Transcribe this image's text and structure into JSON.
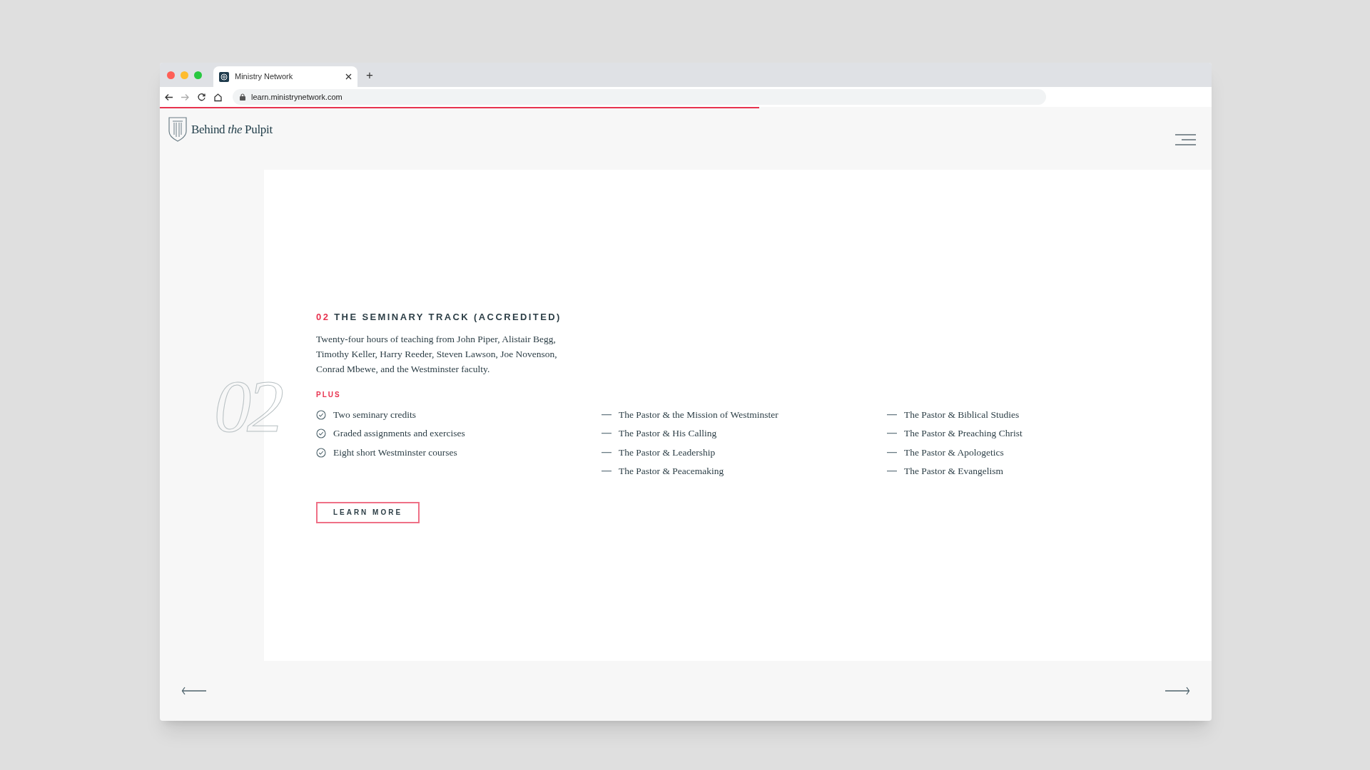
{
  "browser": {
    "tab": {
      "title": "Ministry Network",
      "selected": true
    },
    "new_tab": "+",
    "url": "learn.ministrynetwork.com",
    "progress": {
      "level": 0.57
    }
  },
  "header": {
    "logo": "Behind *the* Pulpit"
  },
  "section": {
    "number": "02",
    "index": "02",
    "title": "THE SEMINARY TRACK (ACCREDITED)",
    "description": "Twenty-four hours of teaching from John Piper, Alistair Begg, Timothy Keller, Harry Reeder, Steven Lawson, Joe Novenson, Conrad Mbewe, and the Westminster faculty.",
    "plus_label": "PLUS",
    "features": [
      "Two seminary credits",
      "Graded assignments and exercises",
      "Eight short Westminster courses"
    ],
    "courses": [
      [
        "The Pastor & the Mission of Westminster",
        "The Pastor & His Calling",
        "The Pastor & Leadership",
        "The Pastor & Peacemaking"
      ],
      [
        "The Pastor & Biblical Studies",
        "The Pastor & Preaching Christ",
        "The Pastor & Apologetics",
        "The Pastor & Evangelism"
      ]
    ],
    "button": "LEARN MORE"
  }
}
